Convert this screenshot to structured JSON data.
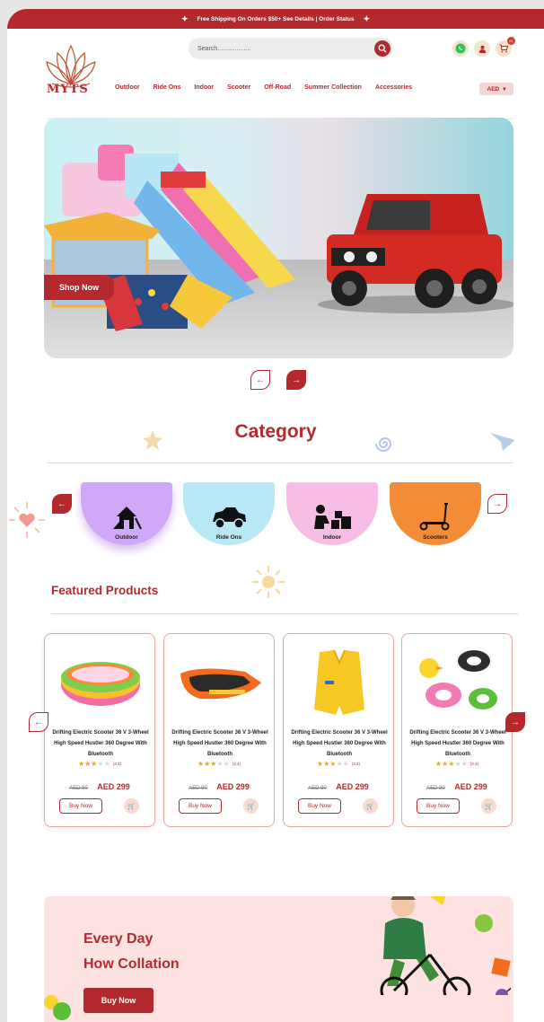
{
  "topbar": {
    "text": "Free Shipping On Orders $50+ See Details | Order Status"
  },
  "header": {
    "logo_text": "MYTS",
    "search_placeholder": "Search...................",
    "cart_count": "01",
    "nav": [
      "Outdoor",
      "Ride Ons",
      "Indoor",
      "Scooter",
      "Off-Road",
      "Summer Collection",
      "Accessories"
    ],
    "currency": "AED"
  },
  "hero": {
    "cta": "Shop Now",
    "prev_icon": "←",
    "next_icon": "→"
  },
  "category": {
    "title": "Category",
    "items": [
      {
        "label": "Outdoor",
        "color": "#cfa8f7"
      },
      {
        "label": "Ride Ons",
        "color": "#b8e8f5"
      },
      {
        "label": "Indoor",
        "color": "#f8bde5"
      },
      {
        "label": "Scooters",
        "color": "#f28c37"
      }
    ]
  },
  "featured": {
    "title": "Featured Products",
    "products": [
      {
        "name": "Drifting Electric Scooter 36 V 3-Wheel High Speed  Hustler  360 Degree  With Bluetooth",
        "stars": 3,
        "rating": "(3.4)",
        "old_price": "AED 90",
        "price": "AED 299",
        "buy": "Buy Now"
      },
      {
        "name": "Drifting Electric Scooter 36 V 3-Wheel High Speed  Hustler  360 Degree  With Bluetooth",
        "stars": 3,
        "rating": "(3.4)",
        "old_price": "AED 90",
        "price": "AED 299",
        "buy": "Buy Now"
      },
      {
        "name": "Drifting Electric Scooter 36 V 3-Wheel High Speed  Hustler  360 Degree  With Bluetooth",
        "stars": 3,
        "rating": "(3.4)",
        "old_price": "AED 90",
        "price": "AED 299",
        "buy": "Buy Now"
      },
      {
        "name": "Drifting Electric Scooter 36 V 3-Wheel High Speed  Hustler  360 Degree  With Bluetooth",
        "stars": 3,
        "rating": "(3.4)",
        "old_price": "AED 90",
        "price": "AED 299",
        "buy": "Buy Now"
      }
    ]
  },
  "promo": {
    "line1": "Every Day",
    "line2": "How Collation",
    "cta": "Buy Now"
  },
  "colors": {
    "brand": "#b3292e",
    "star": "#f0a415"
  }
}
